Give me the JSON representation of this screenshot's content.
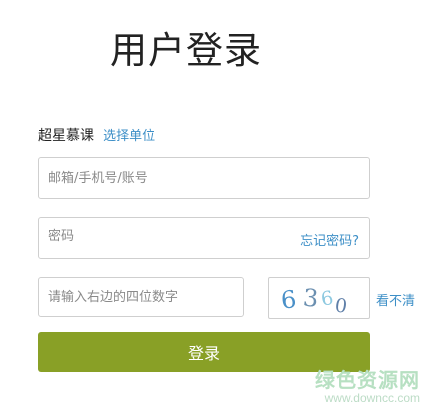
{
  "page": {
    "title": "用户登录"
  },
  "org": {
    "name": "超星慕课",
    "select_label": "选择单位"
  },
  "account": {
    "placeholder": "邮箱/手机号/账号"
  },
  "password": {
    "placeholder": "密码",
    "forgot_label": "忘记密码?"
  },
  "captcha": {
    "placeholder": "请输入右边的四位数字",
    "digits": [
      "6",
      "3",
      "6",
      "0"
    ],
    "digit_colors": [
      "#4a90c8",
      "#6b8fb0",
      "#8ec9e0",
      "#5f7fa8"
    ],
    "refresh_label": "看不清"
  },
  "login": {
    "label": "登录",
    "color": "#89a026"
  },
  "watermark": {
    "main": "绿色资源网",
    "sub": "www.downcc.com"
  }
}
